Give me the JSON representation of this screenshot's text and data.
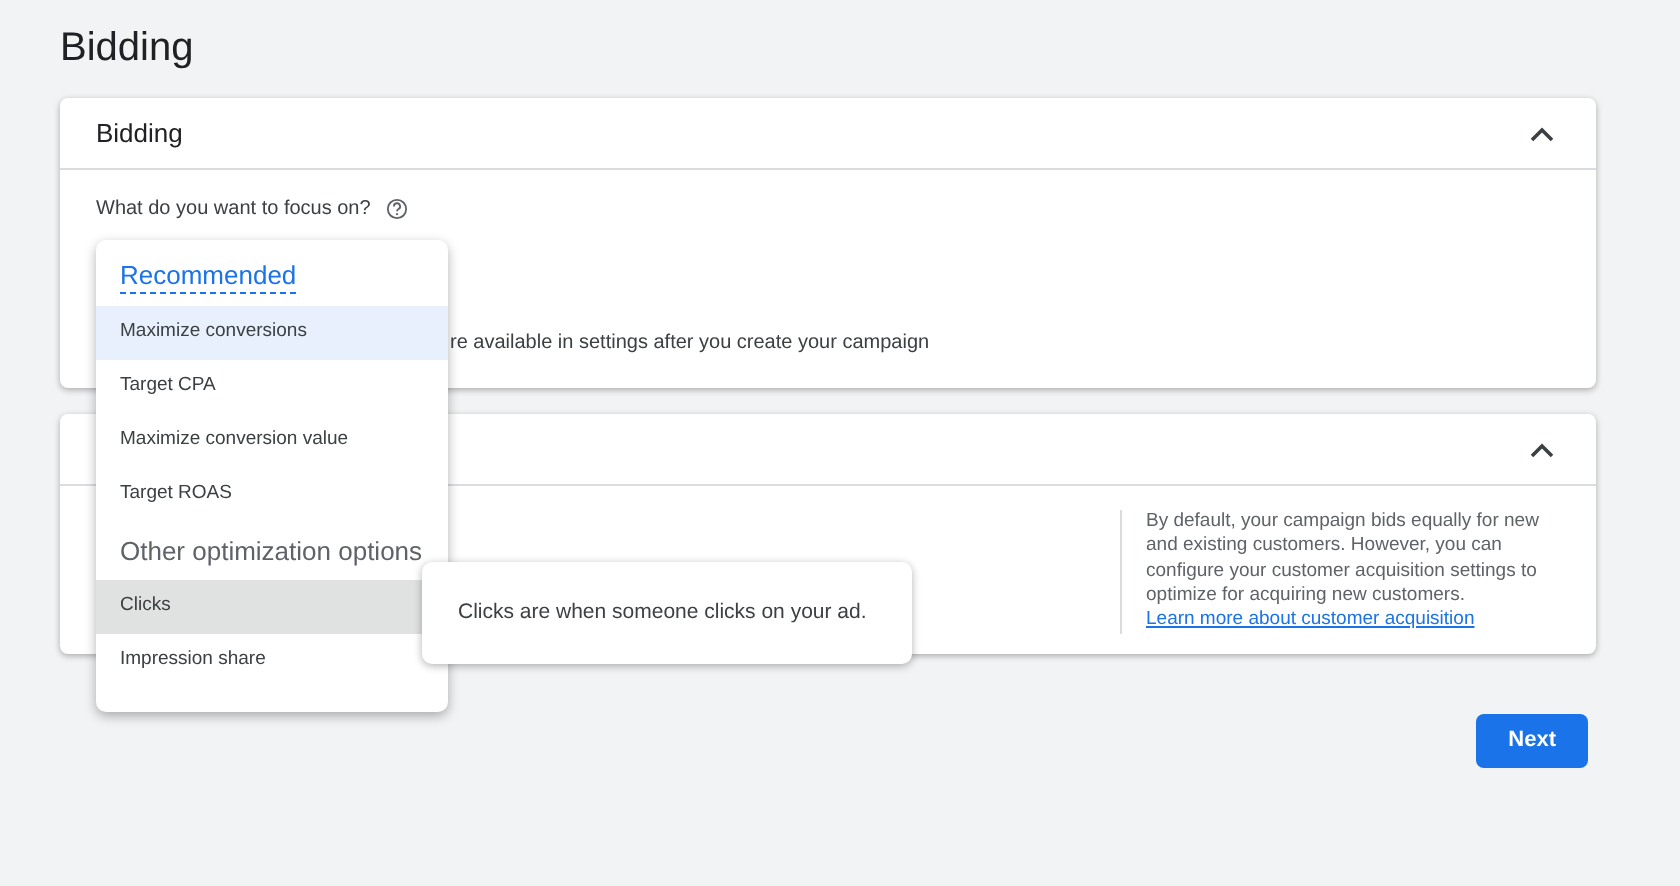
{
  "page_title": "Bidding",
  "bidding_card": {
    "title": "Bidding",
    "expanded": true,
    "question": "What do you want to focus on?",
    "note": "re available in settings after you create your campaign"
  },
  "customer_card": {
    "expanded": true,
    "info": "By default, your campaign bids equally for new and existing customers. However, you can configure your customer acquisition settings to optimize for acquiring new customers.",
    "info_link": "Learn more about customer acquisition"
  },
  "menu": {
    "items": [
      {
        "kind": "link-heading",
        "label": "Recommended"
      },
      {
        "kind": "option",
        "label": "Maximize conversions",
        "selected": true,
        "hovered": false
      },
      {
        "kind": "option",
        "label": "Target CPA",
        "selected": false,
        "hovered": false
      },
      {
        "kind": "option",
        "label": "Maximize conversion value",
        "selected": false,
        "hovered": false
      },
      {
        "kind": "option",
        "label": "Target ROAS",
        "selected": false,
        "hovered": false
      },
      {
        "kind": "heading",
        "label": "Other optimization options"
      },
      {
        "kind": "option",
        "label": "Clicks",
        "selected": false,
        "hovered": true
      },
      {
        "kind": "option",
        "label": "Impression share",
        "selected": false,
        "hovered": false
      }
    ]
  },
  "tooltip": "Clicks are when someone clicks on your ad.",
  "next_button": "Next"
}
